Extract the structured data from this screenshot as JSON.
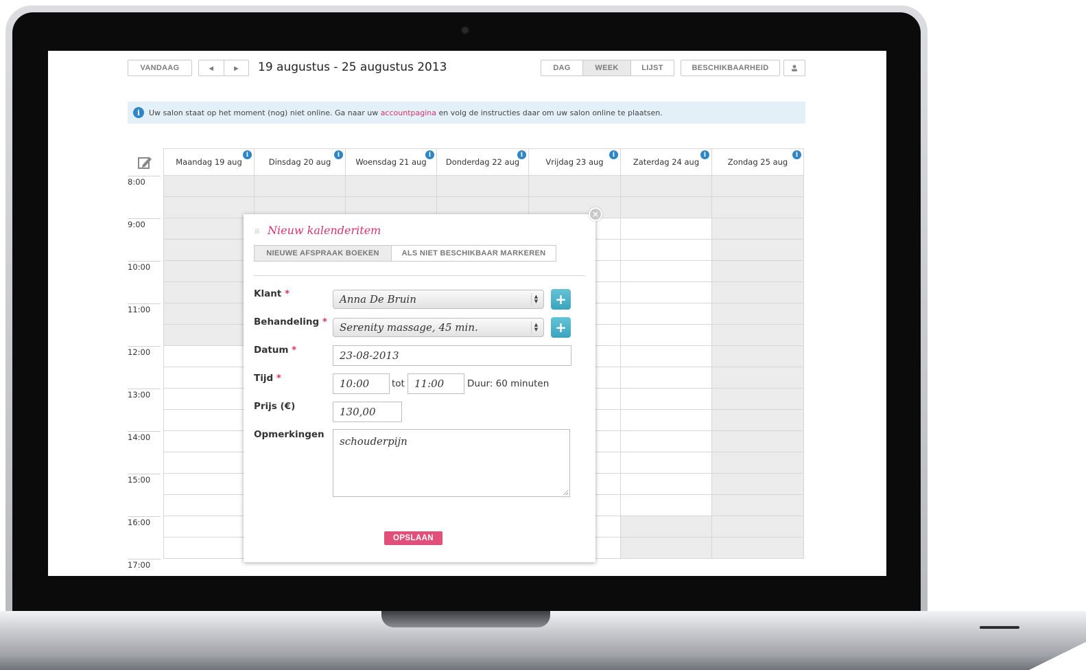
{
  "toolbar": {
    "today_label": "VANDAAG",
    "prev_icon": "◀",
    "next_icon": "▶",
    "date_range": "19 augustus - 25 augustus 2013",
    "views": [
      "DAG",
      "WEEK",
      "LIJST"
    ],
    "active_view": "WEEK",
    "availability_label": "BESCHIKBAARHEID",
    "user_icon": "person-icon"
  },
  "notice": {
    "icon": "i",
    "text_before": "Uw salon staat op het moment (nog) niet online. Ga naar uw ",
    "link": "accountpagina",
    "text_after": " en volg de instructies daar om uw salon online te plaatsen.",
    "link_color": "#d6336c"
  },
  "calendar": {
    "days": [
      "Maandag 19 aug",
      "Dinsdag 20 aug",
      "Woensdag 21 aug",
      "Donderdag 22 aug",
      "Vrijdag 23 aug",
      "Zaterdag 24 aug",
      "Zondag 25 aug"
    ],
    "day_info_icon": "i",
    "times": [
      "8:00",
      "9:00",
      "10:00",
      "11:00",
      "12:00",
      "13:00",
      "14:00",
      "15:00",
      "16:00",
      "17:00"
    ],
    "busy_color": "#ececec"
  },
  "dialog": {
    "title": "Nieuw kalenderitem",
    "close_icon": "×",
    "tabs": [
      "NIEUWE AFSPRAAK BOEKEN",
      "ALS NIET BESCHIKBAAR MARKEREN"
    ],
    "active_tab": "NIEUWE AFSPRAAK BOEKEN",
    "required_mark": "*",
    "client": {
      "label": "Klant",
      "value": "Anna De Bruin"
    },
    "treatment": {
      "label": "Behandeling",
      "value": "Serenity massage, 45 min."
    },
    "date": {
      "label": "Datum",
      "value": "23-08-2013"
    },
    "time": {
      "label": "Tijd",
      "from": "10:00",
      "to_label": "tot",
      "to": "11:00",
      "duration": "Duur: 60 minuten"
    },
    "price": {
      "label": "Prijs (€)",
      "value": "130,00"
    },
    "notes": {
      "label": "Opmerkingen",
      "value": "schouderpijn"
    },
    "add_icon": "+",
    "save_label": "OPSLAAN",
    "accent_color": "#e0507a"
  }
}
